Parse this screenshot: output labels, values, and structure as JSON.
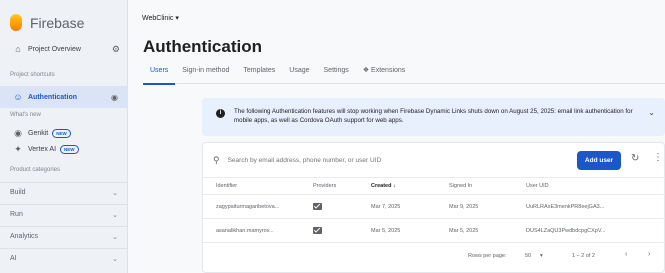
{
  "sidebar": {
    "brand": "Firebase",
    "project_overview": "Project Overview",
    "shortcuts_header": "Project shortcuts",
    "auth_item": "Authentication",
    "whats_new_header": "What's new",
    "genkit": "Genkit",
    "vertex": "Vertex AI",
    "new_badge": "NEW",
    "categories_header": "Product categories",
    "categories": [
      "Build",
      "Run",
      "Analytics",
      "AI"
    ]
  },
  "topbar": {
    "project": "WebClinic ▾"
  },
  "page": {
    "title": "Authentication",
    "tabs": [
      "Users",
      "Sign-in method",
      "Templates",
      "Usage",
      "Settings",
      "Extensions"
    ]
  },
  "banner": {
    "text": "The following Authentication features will stop working when Firebase Dynamic Links shuts down on August 25, 2025: email link authentication for mobile apps, as well as Cordova OAuth support for web apps."
  },
  "users": {
    "search_placeholder": "Search by email address, phone number, or user UID",
    "add_user": "Add user",
    "columns": [
      "Identifier",
      "Providers",
      "Created ↓",
      "Signed In",
      "User UID"
    ],
    "rows": [
      {
        "identifier": "zagypaiturmagaribetova...",
        "created": "Mar 7, 2025",
        "signed_in": "Mar 9, 2025",
        "uid": "UuRLRAxE3menkPR8eejGA3..."
      },
      {
        "identifier": "asanalikhan.mamyrov...",
        "created": "Mar 5, 2025",
        "signed_in": "Mar 5, 2025",
        "uid": "DUS4LZaQU3PwdbdcpgCXpV..."
      }
    ],
    "pager": {
      "label": "Rows per page:",
      "size": "50",
      "range": "1 – 2 of 2"
    }
  }
}
